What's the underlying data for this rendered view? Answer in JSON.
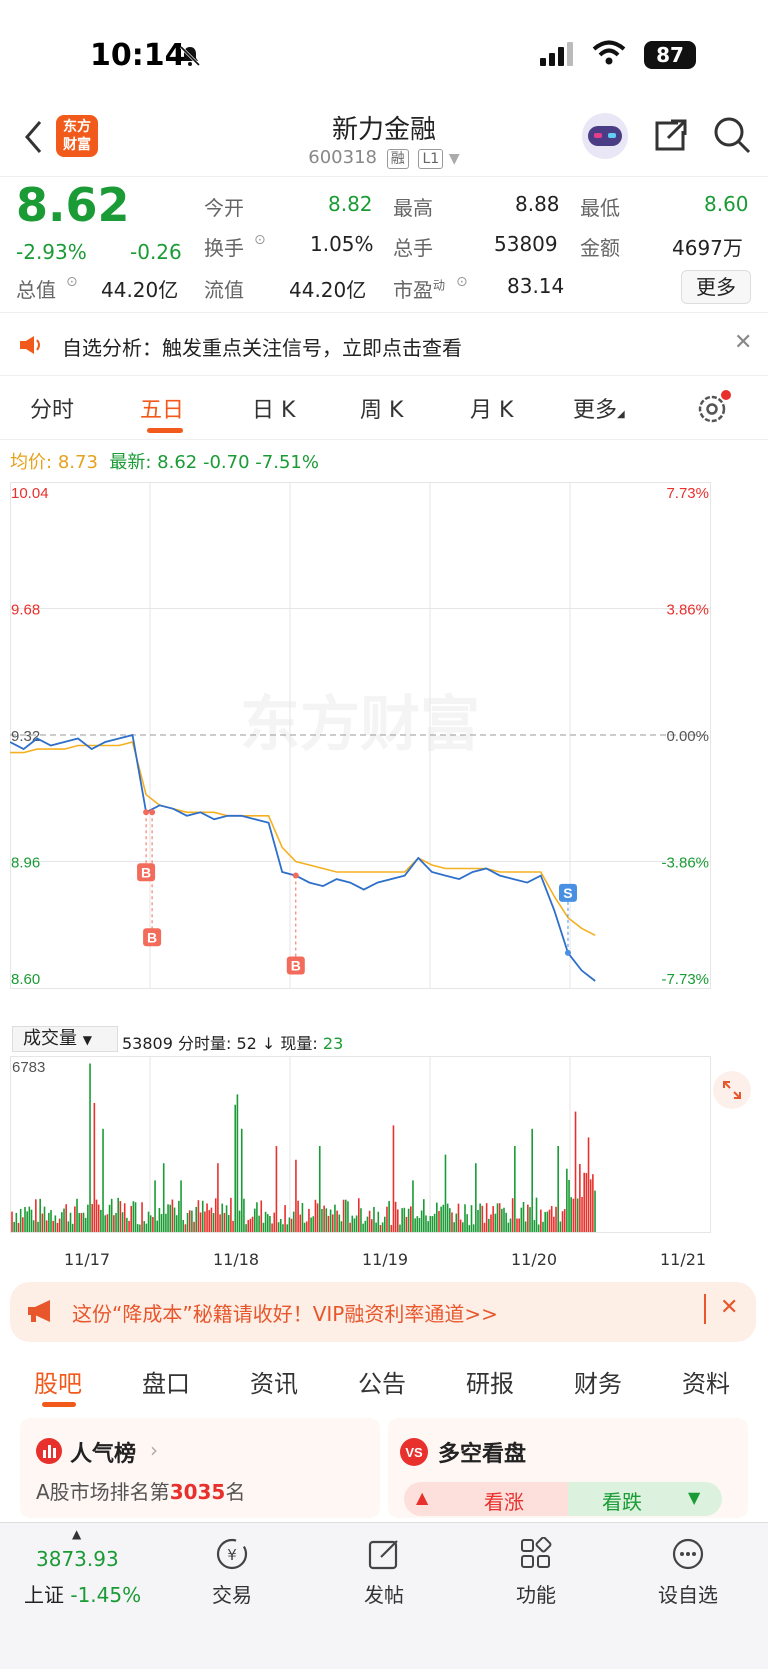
{
  "status_bar": {
    "time": "10:14",
    "battery": "87"
  },
  "header": {
    "logo_line1": "东方",
    "logo_line2": "财富",
    "title": "新力金融",
    "code": "600318",
    "tag1": "融",
    "tag2": "L1"
  },
  "quote": {
    "price": "8.62",
    "change_pct": "-2.93%",
    "change": "-0.26",
    "open_label": "今开",
    "open": "8.82",
    "high_label": "最高",
    "high": "8.88",
    "low_label": "最低",
    "low": "8.60",
    "turnover_label": "换手",
    "turnover": "1.05%",
    "volume_label": "总手",
    "volume": "53809",
    "amount_label": "金额",
    "amount": "4697万",
    "mktcap_label": "总值",
    "mktcap": "44.20亿",
    "float_label": "流值",
    "float": "44.20亿",
    "pe_label": "市盈",
    "pe_sup": "动",
    "pe": "83.14",
    "more": "更多"
  },
  "notice": {
    "text": "自选分析：触发重点关注信号，立即点击查看"
  },
  "tabs": [
    "分时",
    "五日",
    "日 K",
    "周 K",
    "月 K",
    "更多"
  ],
  "chart_info": {
    "avg_label": "均价:",
    "avg": "8.73",
    "latest_label": "最新:",
    "latest": "8.62",
    "chg": "-0.70",
    "chg_pct": "-7.51%"
  },
  "watermark": "东方财富",
  "chart_data": {
    "type": "line",
    "y_left_ticks": [
      "10.04",
      "9.68",
      "9.32",
      "8.96",
      "8.60"
    ],
    "y_right_ticks": [
      "7.73%",
      "3.86%",
      "0.00%",
      "-3.86%",
      "-7.73%"
    ],
    "ylim": [
      8.6,
      10.04
    ],
    "x_categories": [
      "11/17",
      "11/18",
      "11/19",
      "11/20",
      "11/21"
    ],
    "series": [
      {
        "values": [
          9.3,
          9.28,
          9.31,
          9.29,
          9.3,
          9.31,
          9.28,
          9.3,
          9.31,
          9.32,
          9.1,
          9.12,
          9.11,
          9.09,
          9.1,
          9.08,
          9.09,
          9.09,
          9.08,
          9.07,
          8.93,
          8.92,
          8.9,
          8.89,
          8.91,
          8.9,
          8.88,
          8.9,
          8.91,
          8.92,
          8.97,
          8.93,
          8.92,
          8.91,
          8.93,
          8.94,
          8.92,
          8.91,
          8.9,
          8.92,
          8.82,
          8.7,
          8.65,
          8.62
        ]
      },
      {
        "values": [
          9.27,
          9.27,
          9.28,
          9.28,
          9.28,
          9.29,
          9.29,
          9.29,
          9.29,
          9.3,
          9.15,
          9.12,
          9.11,
          9.1,
          9.1,
          9.1,
          9.09,
          9.09,
          9.09,
          9.09,
          9.0,
          8.96,
          8.95,
          8.94,
          8.93,
          8.93,
          8.93,
          8.93,
          8.93,
          8.93,
          8.97,
          8.95,
          8.94,
          8.94,
          8.94,
          8.94,
          8.93,
          8.93,
          8.93,
          8.93,
          8.86,
          8.8,
          8.77,
          8.75
        ]
      }
    ],
    "markers": [
      "B",
      "B",
      "B",
      "S"
    ]
  },
  "volume": {
    "selector": "成交量",
    "summary": "53809 分时量: 52 ↓ 现量:",
    "current": "23",
    "max_label": "6783"
  },
  "volume_data": {
    "type": "bar",
    "ylim": [
      0,
      6783
    ]
  },
  "banner": {
    "text": "这份“降成本”秘籍请收好！VIP融资利率通道>>"
  },
  "bottom_tabs": [
    "股吧",
    "盘口",
    "资讯",
    "公告",
    "研报",
    "财务",
    "资料"
  ],
  "cards": {
    "left_title": "人气榜",
    "left_text_prefix": "A股市场排名第",
    "left_rank": "3035",
    "left_text_suffix": "名",
    "right_title": "多空看盘",
    "bull": "看涨",
    "bear": "看跌"
  },
  "bottom_bar": {
    "index_value": "3873.93",
    "index_name": "上证",
    "index_chg": "-1.45%",
    "trade": "交易",
    "post": "发帖",
    "func": "功能",
    "add": "设自选"
  }
}
